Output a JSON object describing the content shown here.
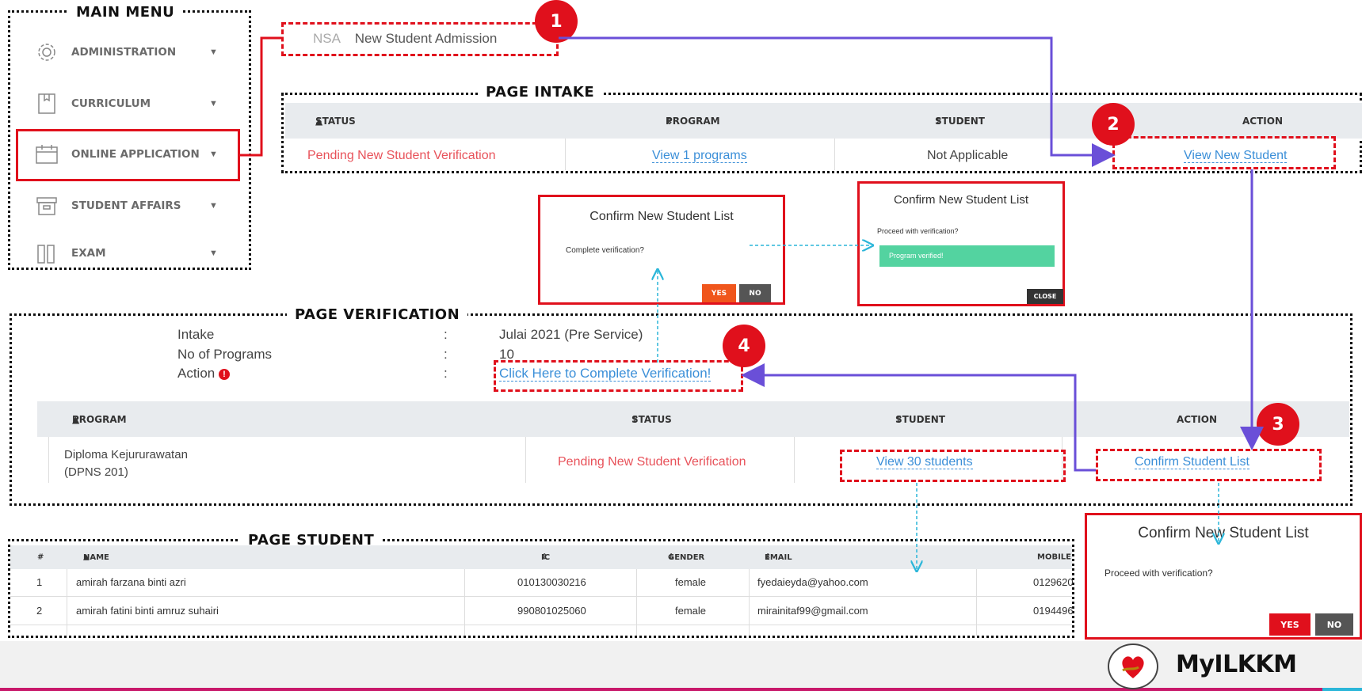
{
  "main_menu": {
    "title": "MAIN MENU",
    "items": [
      {
        "label": "ADMINISTRATION",
        "icon": "gear-icon"
      },
      {
        "label": "CURRICULUM",
        "icon": "book-icon"
      },
      {
        "label": "ONLINE APPLICATION",
        "icon": "calendar-icon"
      },
      {
        "label": "STUDENT AFFAIRS",
        "icon": "archive-icon"
      },
      {
        "label": "EXAM",
        "icon": "exam-icon"
      }
    ]
  },
  "nsa": {
    "code": "NSA",
    "label": "New Student Admission"
  },
  "badges": [
    "1",
    "2",
    "3",
    "4"
  ],
  "page_intake": {
    "title": "PAGE INTAKE",
    "headers": {
      "status": "STATUS",
      "program": "PROGRAM",
      "student": "STUDENT",
      "action": "ACTION"
    },
    "row": {
      "status": "Pending New Student Verification",
      "program": "View 1 programs",
      "student": "Not Applicable",
      "action": "View New Student"
    }
  },
  "modal_complete": {
    "title": "Confirm New Student List",
    "message": "Complete verification?",
    "yes": "YES",
    "no": "NO"
  },
  "modal_verified": {
    "title": "Confirm New Student List",
    "message": "Proceed with verification?",
    "success": "Program verified!",
    "close": "CLOSE"
  },
  "page_verification": {
    "title": "PAGE VERIFICATION",
    "fields": [
      {
        "label": "Intake",
        "sep": ":",
        "value": "Julai 2021 (Pre Service)"
      },
      {
        "label": "No of Programs",
        "sep": ":",
        "value": "10"
      },
      {
        "label": "Action",
        "sep": ":",
        "value": "Click Here to Complete Verification!"
      }
    ],
    "headers": {
      "program": "PROGRAM",
      "status": "STATUS",
      "student": "STUDENT",
      "action": "ACTION"
    },
    "row": {
      "program_line1": "Diploma Kejururawatan",
      "program_line2": "(DPNS 201)",
      "status": "Pending New Student Verification",
      "student": "View 30 students",
      "action": "Confirm Student List"
    }
  },
  "page_student": {
    "title": "PAGE STUDENT",
    "headers": {
      "num": "#",
      "name": "NAME",
      "ic": "IC",
      "gender": "GENDER",
      "email": "EMAIL",
      "mobile": "MOBILE"
    },
    "rows": [
      {
        "num": "1",
        "name": "amirah farzana binti azri",
        "ic": "010130030216",
        "gender": "female",
        "email": "fyedaieyda@yahoo.com",
        "mobile": "0129620"
      },
      {
        "num": "2",
        "name": "amirah fatini binti amruz suhairi",
        "ic": "990801025060",
        "gender": "female",
        "email": "mirainitaf99@gmail.com",
        "mobile": "0194496"
      }
    ]
  },
  "modal_proceed": {
    "title": "Confirm New Student List",
    "message": "Proceed with verification?",
    "yes": "YES",
    "no": "NO"
  },
  "brand": {
    "name": "MyILKKM"
  },
  "colors": {
    "red": "#e0101c",
    "arrow": "#6a4fd8",
    "dash": "#2bb6d9",
    "success": "#53d3a0",
    "orange": "#f0561c"
  }
}
